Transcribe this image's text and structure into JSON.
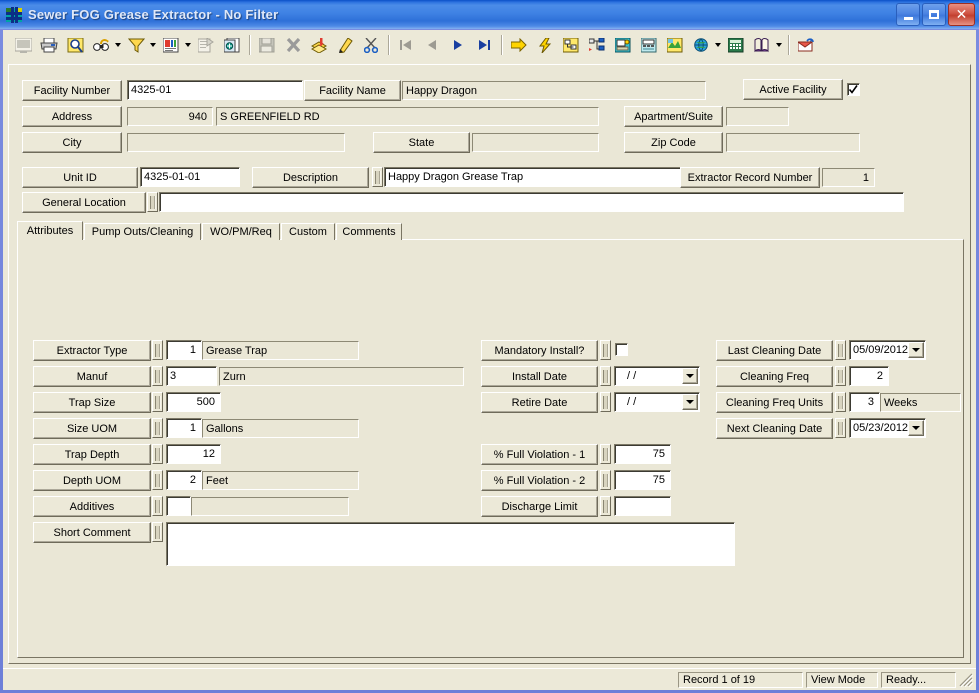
{
  "window": {
    "title": "Sewer FOG Grease Extractor - No Filter",
    "icon": "app-icon",
    "minimize_label": "Minimize",
    "maximize_label": "Maximize",
    "close_label": "Close"
  },
  "toolbar": {
    "items": [
      {
        "name": "screen-icon",
        "title": "Screen",
        "disabled": true
      },
      {
        "name": "print-icon",
        "title": "Print",
        "disabled": false
      },
      {
        "name": "print-preview-icon",
        "title": "Print Preview",
        "disabled": false
      },
      {
        "name": "find-icon",
        "title": "Find",
        "disabled": false,
        "dropdown": true
      },
      {
        "name": "filter-icon",
        "title": "Filter",
        "disabled": false,
        "dropdown": true
      },
      {
        "name": "report-icon",
        "title": "Report",
        "disabled": false,
        "dropdown": true
      },
      {
        "name": "properties-icon",
        "title": "Properties",
        "disabled": true
      },
      {
        "name": "copy-record-icon",
        "title": "Copy Record",
        "disabled": false
      },
      {
        "name": "save-icon",
        "title": "Save",
        "disabled": true
      },
      {
        "name": "delete-icon",
        "title": "Delete",
        "disabled": false
      },
      {
        "name": "new-record-icon",
        "title": "New Record",
        "disabled": false
      },
      {
        "name": "edit-icon",
        "title": "Edit",
        "disabled": false
      },
      {
        "name": "cut-icon",
        "title": "Cut",
        "disabled": false
      },
      {
        "name": "first-record-icon",
        "title": "First Record",
        "disabled": true
      },
      {
        "name": "previous-record-icon",
        "title": "Previous Record",
        "disabled": true
      },
      {
        "name": "next-record-icon",
        "title": "Next Record",
        "disabled": false
      },
      {
        "name": "last-record-icon",
        "title": "Last Record",
        "disabled": false
      },
      {
        "name": "goto-icon",
        "title": "Go To",
        "disabled": false
      },
      {
        "name": "lightning-icon",
        "title": "Quick Action",
        "disabled": false
      },
      {
        "name": "workflow-icon",
        "title": "Workflow",
        "disabled": false
      },
      {
        "name": "hierarchy-icon",
        "title": "Hierarchy",
        "disabled": false
      },
      {
        "name": "desktop-icon",
        "title": "Desktop",
        "disabled": false
      },
      {
        "name": "fax-icon",
        "title": "Fax",
        "disabled": false
      },
      {
        "name": "map-icon",
        "title": "Map",
        "disabled": false
      },
      {
        "name": "globe-icon",
        "title": "Internet",
        "disabled": false,
        "dropdown": true
      },
      {
        "name": "calculator-icon",
        "title": "Calculator",
        "disabled": false
      },
      {
        "name": "book-icon",
        "title": "Help Book",
        "disabled": false,
        "dropdown": true
      },
      {
        "name": "export-icon",
        "title": "Export",
        "disabled": false
      }
    ]
  },
  "header": {
    "facility_number_label": "Facility Number",
    "facility_number_value": "4325-01",
    "facility_name_label": "Facility Name",
    "facility_name_value": "Happy Dragon",
    "active_facility_label": "Active Facility",
    "active_facility_checked": true,
    "address_label": "Address",
    "address_number_value": "940",
    "address_street_value": "S GREENFIELD RD",
    "apartment_label": "Apartment/Suite",
    "apartment_value": "",
    "city_label": "City",
    "city_value": "",
    "state_label": "State",
    "state_value": "",
    "zip_label": "Zip Code",
    "zip_value": "",
    "unit_id_label": "Unit ID",
    "unit_id_value": "4325-01-01",
    "description_label": "Description",
    "description_value": "Happy Dragon Grease Trap",
    "extractor_record_number_label": "Extractor Record Number",
    "extractor_record_number_value": "1",
    "general_location_label": "General Location",
    "general_location_value": ""
  },
  "tabs": [
    {
      "label": "Attributes",
      "active": true
    },
    {
      "label": "Pump Outs/Cleaning",
      "active": false
    },
    {
      "label": "WO/PM/Req",
      "active": false
    },
    {
      "label": "Custom",
      "active": false
    },
    {
      "label": "Comments",
      "active": false
    }
  ],
  "attributes": {
    "left": [
      {
        "label": "Extractor Type",
        "code": "1",
        "desc": "Grease Trap",
        "code_align": "right"
      },
      {
        "label": "Manuf",
        "code": "3",
        "desc": "Zurn",
        "code_align": "left"
      },
      {
        "label": "Trap Size",
        "code": "500",
        "desc": null,
        "code_align": "right"
      },
      {
        "label": "Size UOM",
        "code": "1",
        "desc": "Gallons",
        "code_align": "right"
      },
      {
        "label": "Trap Depth",
        "code": "12",
        "desc": null,
        "code_align": "right"
      },
      {
        "label": "Depth UOM",
        "code": "2",
        "desc": "Feet",
        "code_align": "right"
      },
      {
        "label": "Additives",
        "code": "",
        "desc": "",
        "code_align": "right"
      }
    ],
    "short_comment_label": "Short Comment",
    "short_comment_value": "",
    "middle": {
      "mandatory_install_label": "Mandatory Install?",
      "mandatory_install_checked": false,
      "install_date_label": "Install Date",
      "install_date_value": "/  /",
      "retire_date_label": "Retire Date",
      "retire_date_value": "/  /",
      "full_violation_1_label": "% Full Violation - 1",
      "full_violation_1_value": "75",
      "full_violation_2_label": "% Full Violation - 2",
      "full_violation_2_value": "75",
      "discharge_limit_label": "Discharge Limit",
      "discharge_limit_value": ""
    },
    "right": {
      "last_cleaning_date_label": "Last Cleaning Date",
      "last_cleaning_date_value": "05/09/2012",
      "cleaning_freq_label": "Cleaning Freq",
      "cleaning_freq_value": "2",
      "cleaning_freq_units_label": "Cleaning Freq Units",
      "cleaning_freq_units_code": "3",
      "cleaning_freq_units_desc": "Weeks",
      "next_cleaning_date_label": "Next Cleaning Date",
      "next_cleaning_date_value": "05/23/2012"
    }
  },
  "statusbar": {
    "record": "Record 1 of 19",
    "mode": "View Mode",
    "state": "Ready..."
  },
  "colors": {
    "title_bar": "#2f74e0",
    "face": "#ece9d8",
    "panel": "#eae7d6",
    "field": "#ffffff",
    "desktop": "#7b8ce0"
  }
}
